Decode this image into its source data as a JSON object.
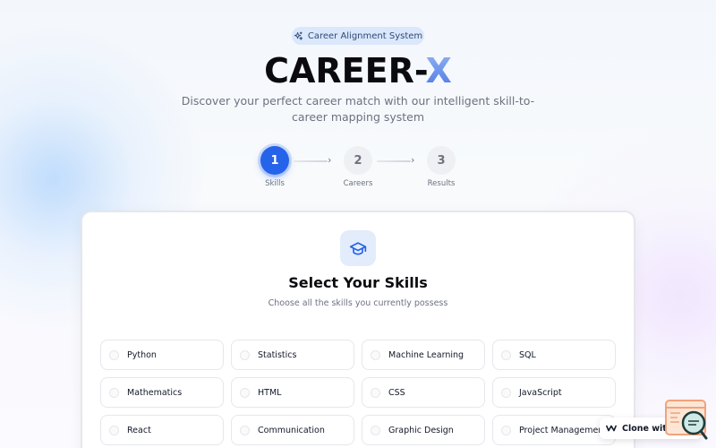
{
  "badge": {
    "label": "Career Alignment System",
    "icon": "sparkles-icon"
  },
  "title": {
    "main": "CAREER-",
    "accent": "X"
  },
  "subtitle": "Discover your perfect career match with our intelligent skill-to-career mapping system",
  "stepper": {
    "steps": [
      {
        "number": "1",
        "label": "Skills",
        "state": "active"
      },
      {
        "number": "2",
        "label": "Careers",
        "state": "inactive"
      },
      {
        "number": "3",
        "label": "Results",
        "state": "inactive"
      }
    ]
  },
  "card": {
    "icon": "graduation-cap-icon",
    "title": "Select Your Skills",
    "subtitle": "Choose all the skills you currently possess",
    "skills": [
      "Python",
      "Statistics",
      "Machine Learning",
      "SQL",
      "Mathematics",
      "HTML",
      "CSS",
      "JavaScript",
      "React",
      "Communication",
      "Graphic Design",
      "Project Management"
    ]
  },
  "widget": {
    "label": "Clone with Mo",
    "icon": "wave-logo-icon"
  },
  "colors": {
    "primary": "#2563eb",
    "accent_start": "#93b4f5",
    "accent_end": "#4b77e3"
  }
}
